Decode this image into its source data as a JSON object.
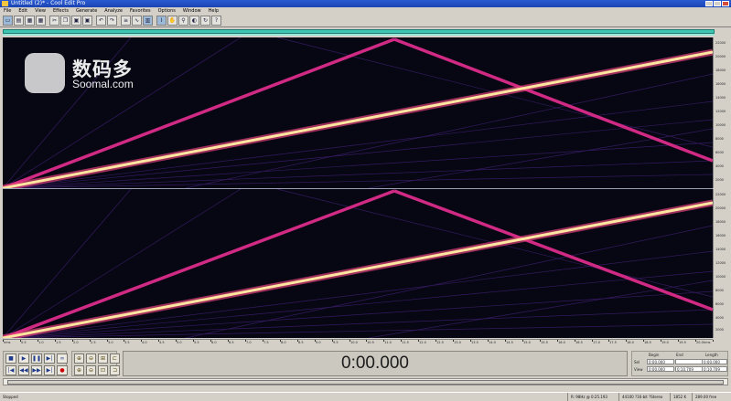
{
  "window": {
    "title": "Untitled (2)* - Cool Edit Pro"
  },
  "menu": [
    "File",
    "Edit",
    "View",
    "Effects",
    "Generate",
    "Analyze",
    "Favorites",
    "Options",
    "Window",
    "Help"
  ],
  "toolbar_icons": [
    "new-file",
    "open",
    "save",
    "save-all",
    "cut",
    "copy",
    "paste",
    "mix-paste",
    "undo",
    "redo",
    "multitrack-view",
    "waveform-view",
    "spectral-view",
    "select-tool",
    "hand-tool",
    "zoom-tool",
    "scrub-tool",
    "loop",
    "help"
  ],
  "watermark": {
    "chinese": "数码多",
    "english": "Soomal.com"
  },
  "spectrogram": {
    "freq_ticks_top": [
      "22000",
      "20000",
      "18000",
      "16000",
      "14000",
      "12000",
      "10000",
      "8000",
      "6000",
      "4000",
      "2000"
    ],
    "freq_ticks_bottom": [
      "22000",
      "20000",
      "18000",
      "16000",
      "14000",
      "12000",
      "10000",
      "8000",
      "6000",
      "4000",
      "2000"
    ],
    "time_ticks": [
      "hms",
      "0.5",
      "1.0",
      "1.5",
      "2.0",
      "2.5",
      "3.0",
      "3.5",
      "4.0",
      "4.5",
      "5.0",
      "5.5",
      "6.0",
      "6.5",
      "7.0",
      "7.5",
      "8.0",
      "8.5",
      "9.0",
      "9.5",
      "10.0",
      "10.5",
      "11.0",
      "11.5",
      "12.0",
      "12.5",
      "13.0",
      "13.5",
      "14.0",
      "14.5",
      "15.0",
      "15.5",
      "16.0",
      "16.5",
      "17.0",
      "17.5",
      "18.0",
      "18.5",
      "19.0",
      "19.5",
      "20.0",
      "hms"
    ]
  },
  "transport": {
    "buttons": [
      "stop",
      "play",
      "pause",
      "play-to-end",
      "loop",
      "go-to-start",
      "rewind",
      "fast-forward",
      "go-to-end",
      "record"
    ]
  },
  "zoom_buttons": [
    "zoom-in-h",
    "zoom-out-h",
    "zoom-full",
    "zoom-in-left",
    "zoom-in-v",
    "zoom-out-v",
    "zoom-selection",
    "zoom-in-right"
  ],
  "time_display": "0:00.000",
  "selection": {
    "headers": [
      "Begin",
      "End",
      "Length"
    ],
    "rows": [
      {
        "label": "Sel",
        "begin": "0:00.000",
        "end": "",
        "length": "0:00.000"
      },
      {
        "label": "View",
        "begin": "0:00.000",
        "end": "0:10.709",
        "length": "0:10.709"
      }
    ]
  },
  "status": {
    "left": "Stopped",
    "cells": [
      "R: 98Hz @ 0:25.193",
      "44100 ?16-bit ?Stereo",
      "1852 K",
      "289.00 free"
    ]
  },
  "colors": {
    "background": "#060713",
    "harmonic": "#d02a84",
    "fundamental": "#ffe6a0",
    "overview": "#3ec5b2"
  }
}
